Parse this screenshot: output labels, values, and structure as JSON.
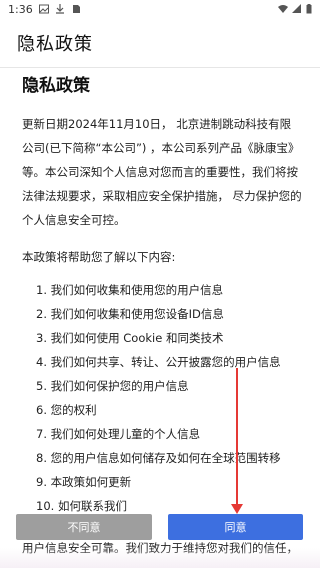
{
  "status_bar": {
    "time": "1:36"
  },
  "header": {
    "title": "隐私政策"
  },
  "document": {
    "title": "隐私政策",
    "intro": "更新日期2024年11月10日， 北京进制跳动科技有限公司(已下简称“本公司”) ，本公司系列产品《脉康宝》等。本公司深知个人信息对您而言的重要性，我们将按法律法规要求，采取相应安全保护措施， 尽力保护您的个人信息安全可控。",
    "toc_intro": "本政策将帮助您了解以下内容:",
    "toc": [
      "1. 我们如何收集和使用您的用户信息",
      "2. 我们如何收集和使用您设备ID信息",
      "3. 我们如何使用 Cookie 和同类技术",
      "4. 我们如何共享、转让、公开披露您的用户信息",
      "5. 我们如何保护您的用户信息",
      "6. 您的权利",
      "7. 我们如何处理儿童的个人信息",
      "8. 您的用户信息如何储存及如何在全球范围转移",
      "9. 本政策如何更新",
      "10. 如何联系我们"
    ],
    "partial_text": "用户信息安全可靠。我们致力于维持您对我们的信任，"
  },
  "buttons": {
    "disagree": "不同意",
    "agree": "同意"
  },
  "colors": {
    "agree": "#3d6fe0",
    "disagree": "#9e9e9e",
    "annotation_arrow": "#e53935"
  }
}
